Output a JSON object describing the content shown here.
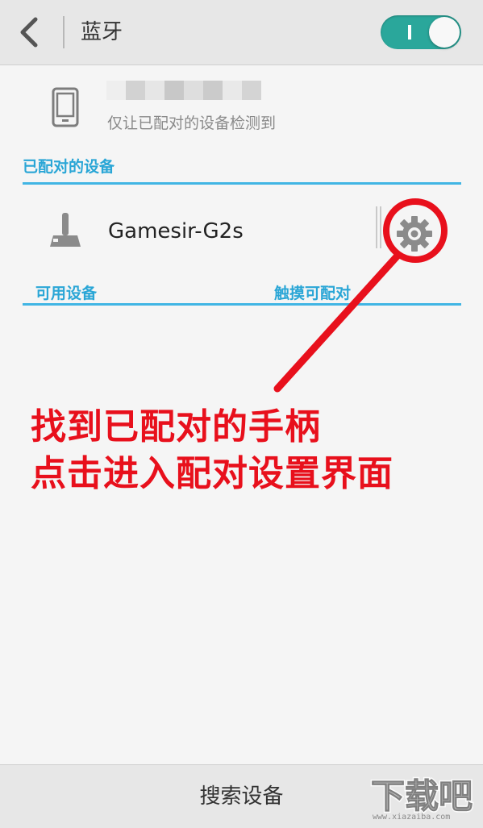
{
  "header": {
    "back_icon": "chevron-left-icon",
    "title": "蓝牙",
    "toggle_state": "on",
    "toggle_color": "#2aa79b"
  },
  "this_device": {
    "icon": "phone-icon",
    "name_redacted": true,
    "visibility_text": "仅让已配对的设备检测到"
  },
  "paired_section": {
    "header": "已配对的设备",
    "devices": [
      {
        "icon": "joystick-icon",
        "name": "Gamesir-G2s",
        "settings_icon": "gear-icon"
      }
    ]
  },
  "available_section": {
    "header": "可用设备",
    "hint": "触摸可配对"
  },
  "annotation": {
    "line1": "找到已配对的手柄",
    "line2": "点击进入配对设置界面",
    "color": "#e8101c"
  },
  "bottom_bar": {
    "search_label": "搜索设备"
  },
  "watermark": {
    "text": "下载吧",
    "url": "www.xiazaiba.com"
  },
  "accent_color": "#2aa6d6"
}
